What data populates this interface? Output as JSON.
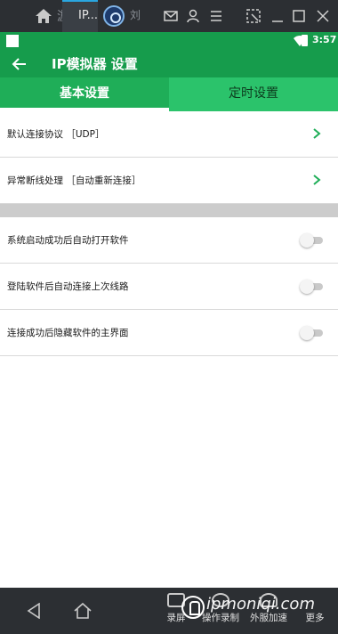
{
  "chrome": {
    "tab_partial_left": "游",
    "active_tab_label": "IP...",
    "tab_partial_right": "刘",
    "icons": [
      "home-icon",
      "tab-app-icon",
      "mail-icon",
      "user-icon",
      "menu-icon",
      "cursor-icon",
      "minimize-icon",
      "maximize-icon",
      "close-icon"
    ]
  },
  "status_bar": {
    "time": "3:57"
  },
  "app_bar": {
    "title": "IP模拟器 设置"
  },
  "tabs": [
    {
      "label": "基本设置",
      "selected": true
    },
    {
      "label": "定时设置",
      "selected": false
    }
  ],
  "settings": {
    "nav_rows": [
      {
        "label": "默认连接协议 ［UDP］"
      },
      {
        "label": "异常断线处理 ［自动重新连接］"
      }
    ],
    "toggle_rows": [
      {
        "label": "系统启动成功后自动打开软件",
        "on": false
      },
      {
        "label": "登陆软件后自动连接上次线路",
        "on": false
      },
      {
        "label": "连接成功后隐藏软件的主界面",
        "on": false
      }
    ]
  },
  "bottom_bar": {
    "items": [
      {
        "label": "录屏"
      },
      {
        "label": "操作录制"
      },
      {
        "label": "外服加速"
      },
      {
        "label": "更多"
      }
    ],
    "watermark": "ipmoniqi.com"
  },
  "colors": {
    "accent_green": "#169c4c",
    "tab_green": "#2bc36b",
    "chrome_dark": "#2c2f33"
  }
}
